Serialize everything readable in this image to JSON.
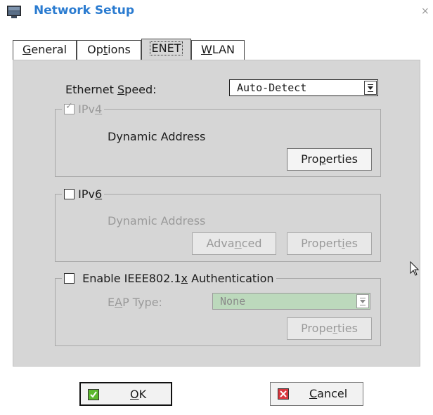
{
  "window": {
    "title": "Network Setup",
    "close_glyph": "×"
  },
  "tabs": [
    {
      "label": "General",
      "mnemonic": "G",
      "rest": "eneral",
      "active": false
    },
    {
      "label": "Options",
      "mnemonic": "",
      "rest": "",
      "active": false
    },
    {
      "label": "ENET",
      "active": true
    },
    {
      "label": "WLAN",
      "mnemonic": "W",
      "rest": "LAN",
      "active": false
    }
  ],
  "ethernet_speed": {
    "label_pre": "Ethernet ",
    "label_mn": "S",
    "label_post": "peed:",
    "value": "Auto-Detect"
  },
  "ipv4": {
    "checked": true,
    "enabled": false,
    "label_pre": "IPv",
    "label_mn": "4",
    "address_text": "Dynamic Address",
    "properties_pre": "Pro",
    "properties_mn": "p",
    "properties_post": "erties"
  },
  "ipv6": {
    "checked": false,
    "label_pre": "IPv",
    "label_mn": "6",
    "address_text": "Dynamic Address",
    "advanced_pre": "Adva",
    "advanced_mn": "n",
    "advanced_post": "ced",
    "properties_pre": "Propert",
    "properties_mn": "i",
    "properties_post": "es"
  },
  "ieee8021x": {
    "checked": false,
    "label_pre": "Enable IEEE802.1",
    "label_mn": "x",
    "label_post": " Authentication",
    "eap_label_pre": "E",
    "eap_label_mn": "A",
    "eap_label_post": "P Type:",
    "eap_value": "None",
    "properties_pre": "Prope",
    "properties_mn": "r",
    "properties_post": "ties"
  },
  "buttons": {
    "ok_mn": "O",
    "ok_post": "K",
    "cancel_mn": "C",
    "cancel_post": "ancel"
  },
  "colors": {
    "title": "#2a7bd0",
    "panel": "#d6d6d6",
    "eap_combo_bg": "#bcd9bc",
    "ok_icon": "#5cb82e",
    "cancel_icon": "#d9363e"
  }
}
